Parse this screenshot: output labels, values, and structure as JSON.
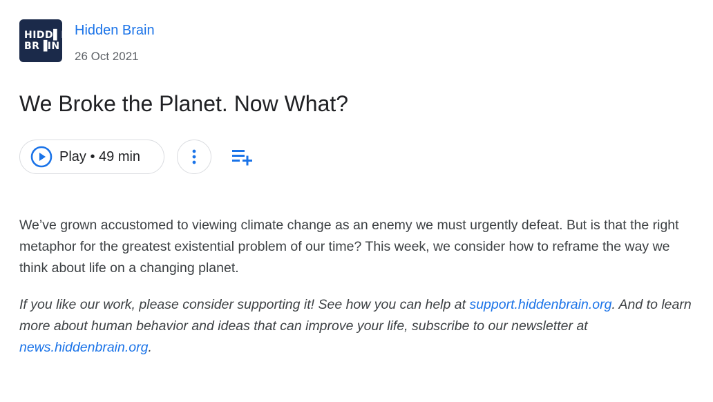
{
  "podcast": {
    "logo_line1": "HIDD▌N",
    "logo_line2": "BR▐IN",
    "name": "Hidden Brain",
    "date": "26 Oct 2021"
  },
  "episode": {
    "title": "We Broke the Planet. Now What?",
    "play_label": "Play • 49 min"
  },
  "icons": {
    "play": "play-circle-icon",
    "more": "more-vert-icon",
    "queue": "playlist-add-icon"
  },
  "colors": {
    "accent": "#1a73e8",
    "logo_bg": "#1b2a4a"
  },
  "description": "We’ve grown accustomed to viewing climate change as an enemy we must urgently defeat. But is that the right metaphor for the greatest existential problem of our time? This week, we consider how to reframe the way we think about life on a changing planet.",
  "support": {
    "text1": "If you like our work, please consider supporting it! See how you can help at ",
    "link1": "support.hiddenbrain.org",
    "text2": ". And to learn more about human behavior and ideas that can improve your life, subscribe to our newsletter at ",
    "link2": "news.hiddenbrain.org",
    "text3": "."
  }
}
